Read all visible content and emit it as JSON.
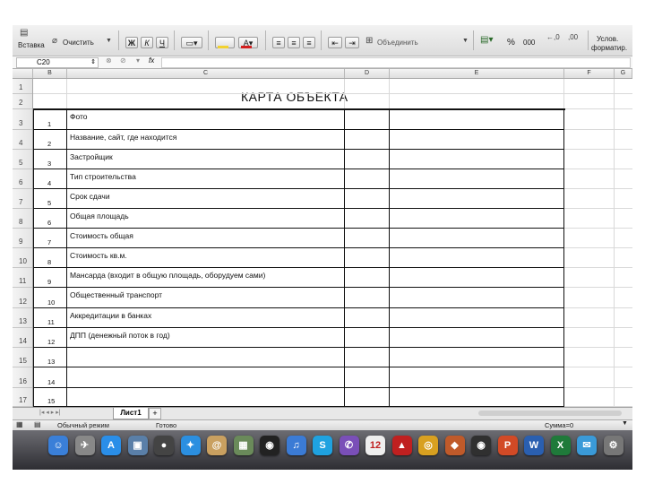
{
  "toolbar": {
    "paste_label": "Вставка",
    "clear_label": "Очистить",
    "bold_label": "Ж",
    "italic_label": "К",
    "underline_label": "Ч",
    "merge_label": "Объединить",
    "percent_label": "%",
    "thousands_label": "000",
    "conditional_label_1": "Услов.",
    "conditional_label_2": "форматир.",
    "accent_fill": "#f2d230",
    "accent_font": "#d42020"
  },
  "formula_bar": {
    "cell_ref": "C20",
    "fx_label": "fx",
    "value": ""
  },
  "columns": [
    "B",
    "C",
    "D",
    "E",
    "F",
    "G"
  ],
  "rows": [
    "1",
    "2",
    "3",
    "4",
    "5",
    "6",
    "7",
    "8",
    "9",
    "10",
    "11",
    "12",
    "13",
    "14",
    "15",
    "16",
    "17"
  ],
  "sheet": {
    "title": "КАРТА ОБЪЕКТА",
    "numbers": [
      "1",
      "2",
      "3",
      "4",
      "5",
      "6",
      "7",
      "8",
      "9",
      "10",
      "11",
      "12",
      "13",
      "14",
      "15"
    ],
    "items": [
      "Фото",
      "Название, сайт, где находится",
      "Застройщик",
      "Тип строительства",
      "Срок сдачи",
      "Общая площадь",
      "Стоимость общая",
      "Стоимость кв.м.",
      "Мансарда (входит в общую площадь, оборудуем сами)",
      "Общественный транспорт",
      "Аккредитации в банках",
      "ДПП (денежный поток в год)"
    ]
  },
  "tabs": {
    "active": "Лист1",
    "add_label": "+"
  },
  "status": {
    "view_mode": "Обычный режим",
    "ready": "Готово",
    "sum": "Сумма=0"
  },
  "dock": [
    {
      "name": "finder-icon",
      "color": "#3a7fd8",
      "glyph": "☺"
    },
    {
      "name": "launchpad-icon",
      "color": "#888888",
      "glyph": "✈"
    },
    {
      "name": "appstore-icon",
      "color": "#2a8ee8",
      "glyph": "A"
    },
    {
      "name": "preview-icon",
      "color": "#5a7fa8",
      "glyph": "▣"
    },
    {
      "name": "facetime-icon",
      "color": "#444444",
      "glyph": "●"
    },
    {
      "name": "safari-icon",
      "color": "#2b8fe0",
      "glyph": "✦"
    },
    {
      "name": "contacts-icon",
      "color": "#c9a060",
      "glyph": "@"
    },
    {
      "name": "calendar-mini-icon",
      "color": "#6a8a5a",
      "glyph": "▦"
    },
    {
      "name": "steam-icon",
      "color": "#222222",
      "glyph": "◉"
    },
    {
      "name": "itunes-icon",
      "color": "#3b7bd5",
      "glyph": "♫"
    },
    {
      "name": "skype-icon",
      "color": "#1fa2e0",
      "glyph": "S"
    },
    {
      "name": "viber-icon",
      "color": "#7a4fb8",
      "glyph": "✆"
    },
    {
      "name": "calendar-icon",
      "color": "#eeeeee",
      "glyph": "12"
    },
    {
      "name": "flashlight-icon",
      "color": "#c02020",
      "glyph": "▲"
    },
    {
      "name": "chrome-icon",
      "color": "#d8a020",
      "glyph": "◎"
    },
    {
      "name": "photos-icon",
      "color": "#c05a2a",
      "glyph": "◆"
    },
    {
      "name": "dvd-player-icon",
      "color": "#303030",
      "glyph": "◉"
    },
    {
      "name": "powerpoint-icon",
      "color": "#d24a26",
      "glyph": "P"
    },
    {
      "name": "word-icon",
      "color": "#2a5fb0",
      "glyph": "W"
    },
    {
      "name": "excel-icon",
      "color": "#1f7a3a",
      "glyph": "X"
    },
    {
      "name": "mail-icon",
      "color": "#3a9ad8",
      "glyph": "✉"
    },
    {
      "name": "system-prefs-icon",
      "color": "#777777",
      "glyph": "⚙"
    }
  ]
}
